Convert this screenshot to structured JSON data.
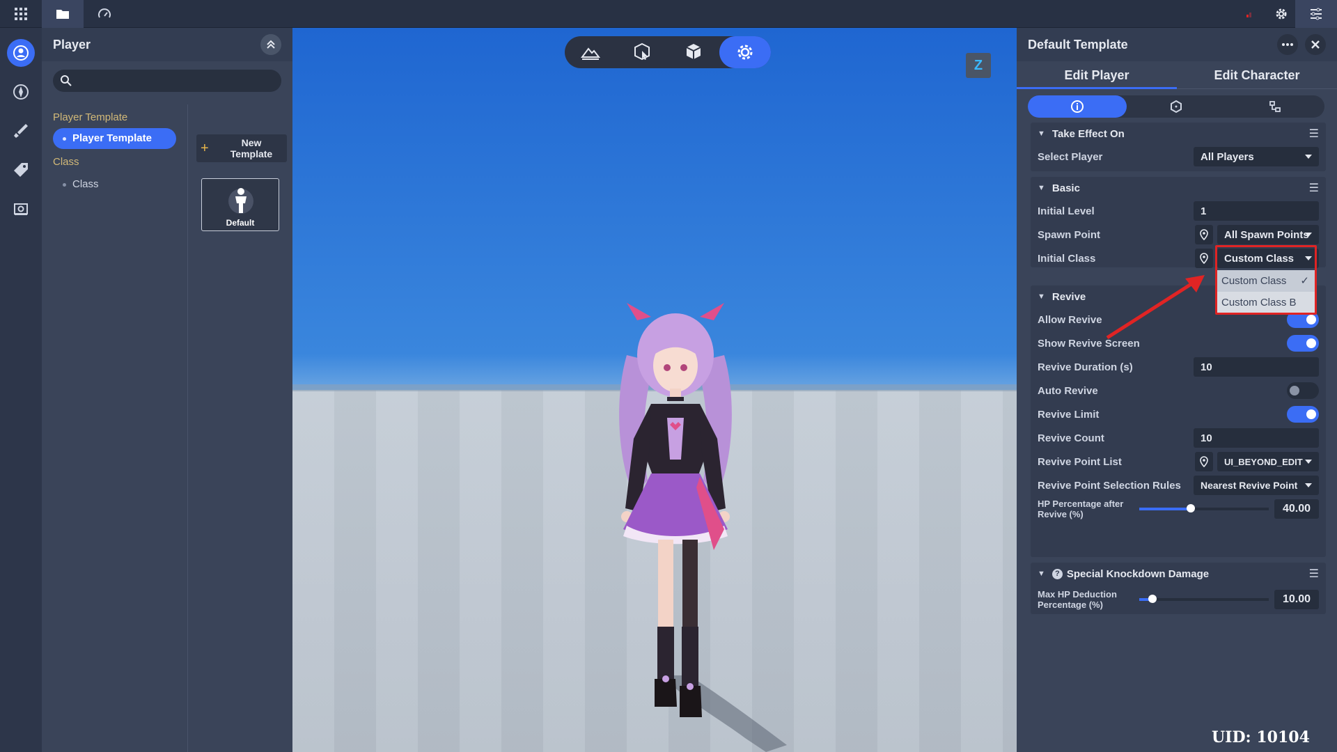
{
  "left_panel": {
    "title": "Player",
    "tree": {
      "group_player_template": "Player Template",
      "item_player_template": "Player Template",
      "group_class": "Class",
      "item_class": "Class"
    },
    "new_template_label": "New\nTemplate",
    "template_card_label": "Default"
  },
  "right_panel": {
    "title": "Default Template",
    "tabs": [
      "Edit Player",
      "Edit Character"
    ],
    "take_effect": {
      "header": "Take Effect On",
      "select_player_label": "Select Player",
      "select_player_value": "All Players"
    },
    "basic": {
      "header": "Basic",
      "initial_level_label": "Initial Level",
      "initial_level_value": "1",
      "spawn_point_label": "Spawn Point",
      "spawn_point_value": "All Spawn Points",
      "initial_class_label": "Initial Class",
      "initial_class_value": "Custom Class"
    },
    "class_dropdown_options": [
      "Custom Class",
      "Custom Class B"
    ],
    "revive": {
      "header": "Revive",
      "allow_revive_label": "Allow Revive",
      "allow_revive_on": true,
      "show_screen_label": "Show Revive Screen",
      "show_screen_on": true,
      "duration_label": "Revive Duration (s)",
      "duration_value": "10",
      "auto_revive_label": "Auto Revive",
      "auto_revive_on": false,
      "limit_label": "Revive Limit",
      "limit_on": true,
      "count_label": "Revive Count",
      "count_value": "10",
      "point_list_label": "Revive Point List",
      "point_list_value": "UI_BEYOND_EDIT",
      "selection_rules_label": "Revive Point Selection Rules",
      "selection_rules_value": "Nearest Revive Point",
      "hp_label": "HP Percentage after Revive (%)",
      "hp_value": "40.00",
      "hp_percent": 40
    },
    "knockdown": {
      "header": "Special Knockdown Damage",
      "max_hp_label": "Max HP Deduction Percentage (%)",
      "max_hp_value": "10.00",
      "max_hp_percent": 10
    }
  },
  "uid": "UID: 10104",
  "z_badge": "Z",
  "colors": {
    "accent": "#3b6df5",
    "highlight_red": "#e02424"
  }
}
